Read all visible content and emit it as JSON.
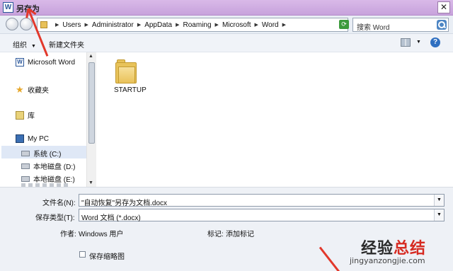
{
  "window": {
    "title": "另存为",
    "app_icon_letter": "W",
    "close_glyph": "✕"
  },
  "address": {
    "crumbs": [
      "Users",
      "Administrator",
      "AppData",
      "Roaming",
      "Microsoft",
      "Word"
    ],
    "search_placeholder": "搜索 Word"
  },
  "toolbar": {
    "organize_label": "组织",
    "new_folder_label": "新建文件夹",
    "help_glyph": "?"
  },
  "sidebar": {
    "items": [
      {
        "label": "Microsoft Word",
        "icon": "word-icon"
      },
      {
        "label": "收藏夹",
        "icon": "star-icon"
      },
      {
        "label": "库",
        "icon": "library-icon"
      },
      {
        "label": "My PC",
        "icon": "pc-icon"
      },
      {
        "label": "系统 (C:)",
        "icon": "drive-icon"
      },
      {
        "label": "本地磁盘 (D:)",
        "icon": "drive-icon"
      },
      {
        "label": "本地磁盘 (E:)",
        "icon": "drive-icon"
      }
    ]
  },
  "content": {
    "folders": [
      {
        "name": "STARTUP"
      }
    ]
  },
  "form": {
    "filename_label": "文件名(N):",
    "filename_value": "\"自动恢复\"另存为文档.docx",
    "filetype_label": "保存类型(T):",
    "filetype_value": "Word 文档 (*.docx)",
    "author_label": "作者:",
    "author_value": "Windows 用户",
    "tags_label": "标记:",
    "tags_value": "添加标记",
    "thumbnail_label": "保存缩略图"
  },
  "watermark": {
    "text_dark": "经验",
    "text_red": "总结",
    "url": "jingyanzongjie.com"
  },
  "colors": {
    "accent_red": "#e2382b",
    "title_bar": "#c7a2dc"
  }
}
